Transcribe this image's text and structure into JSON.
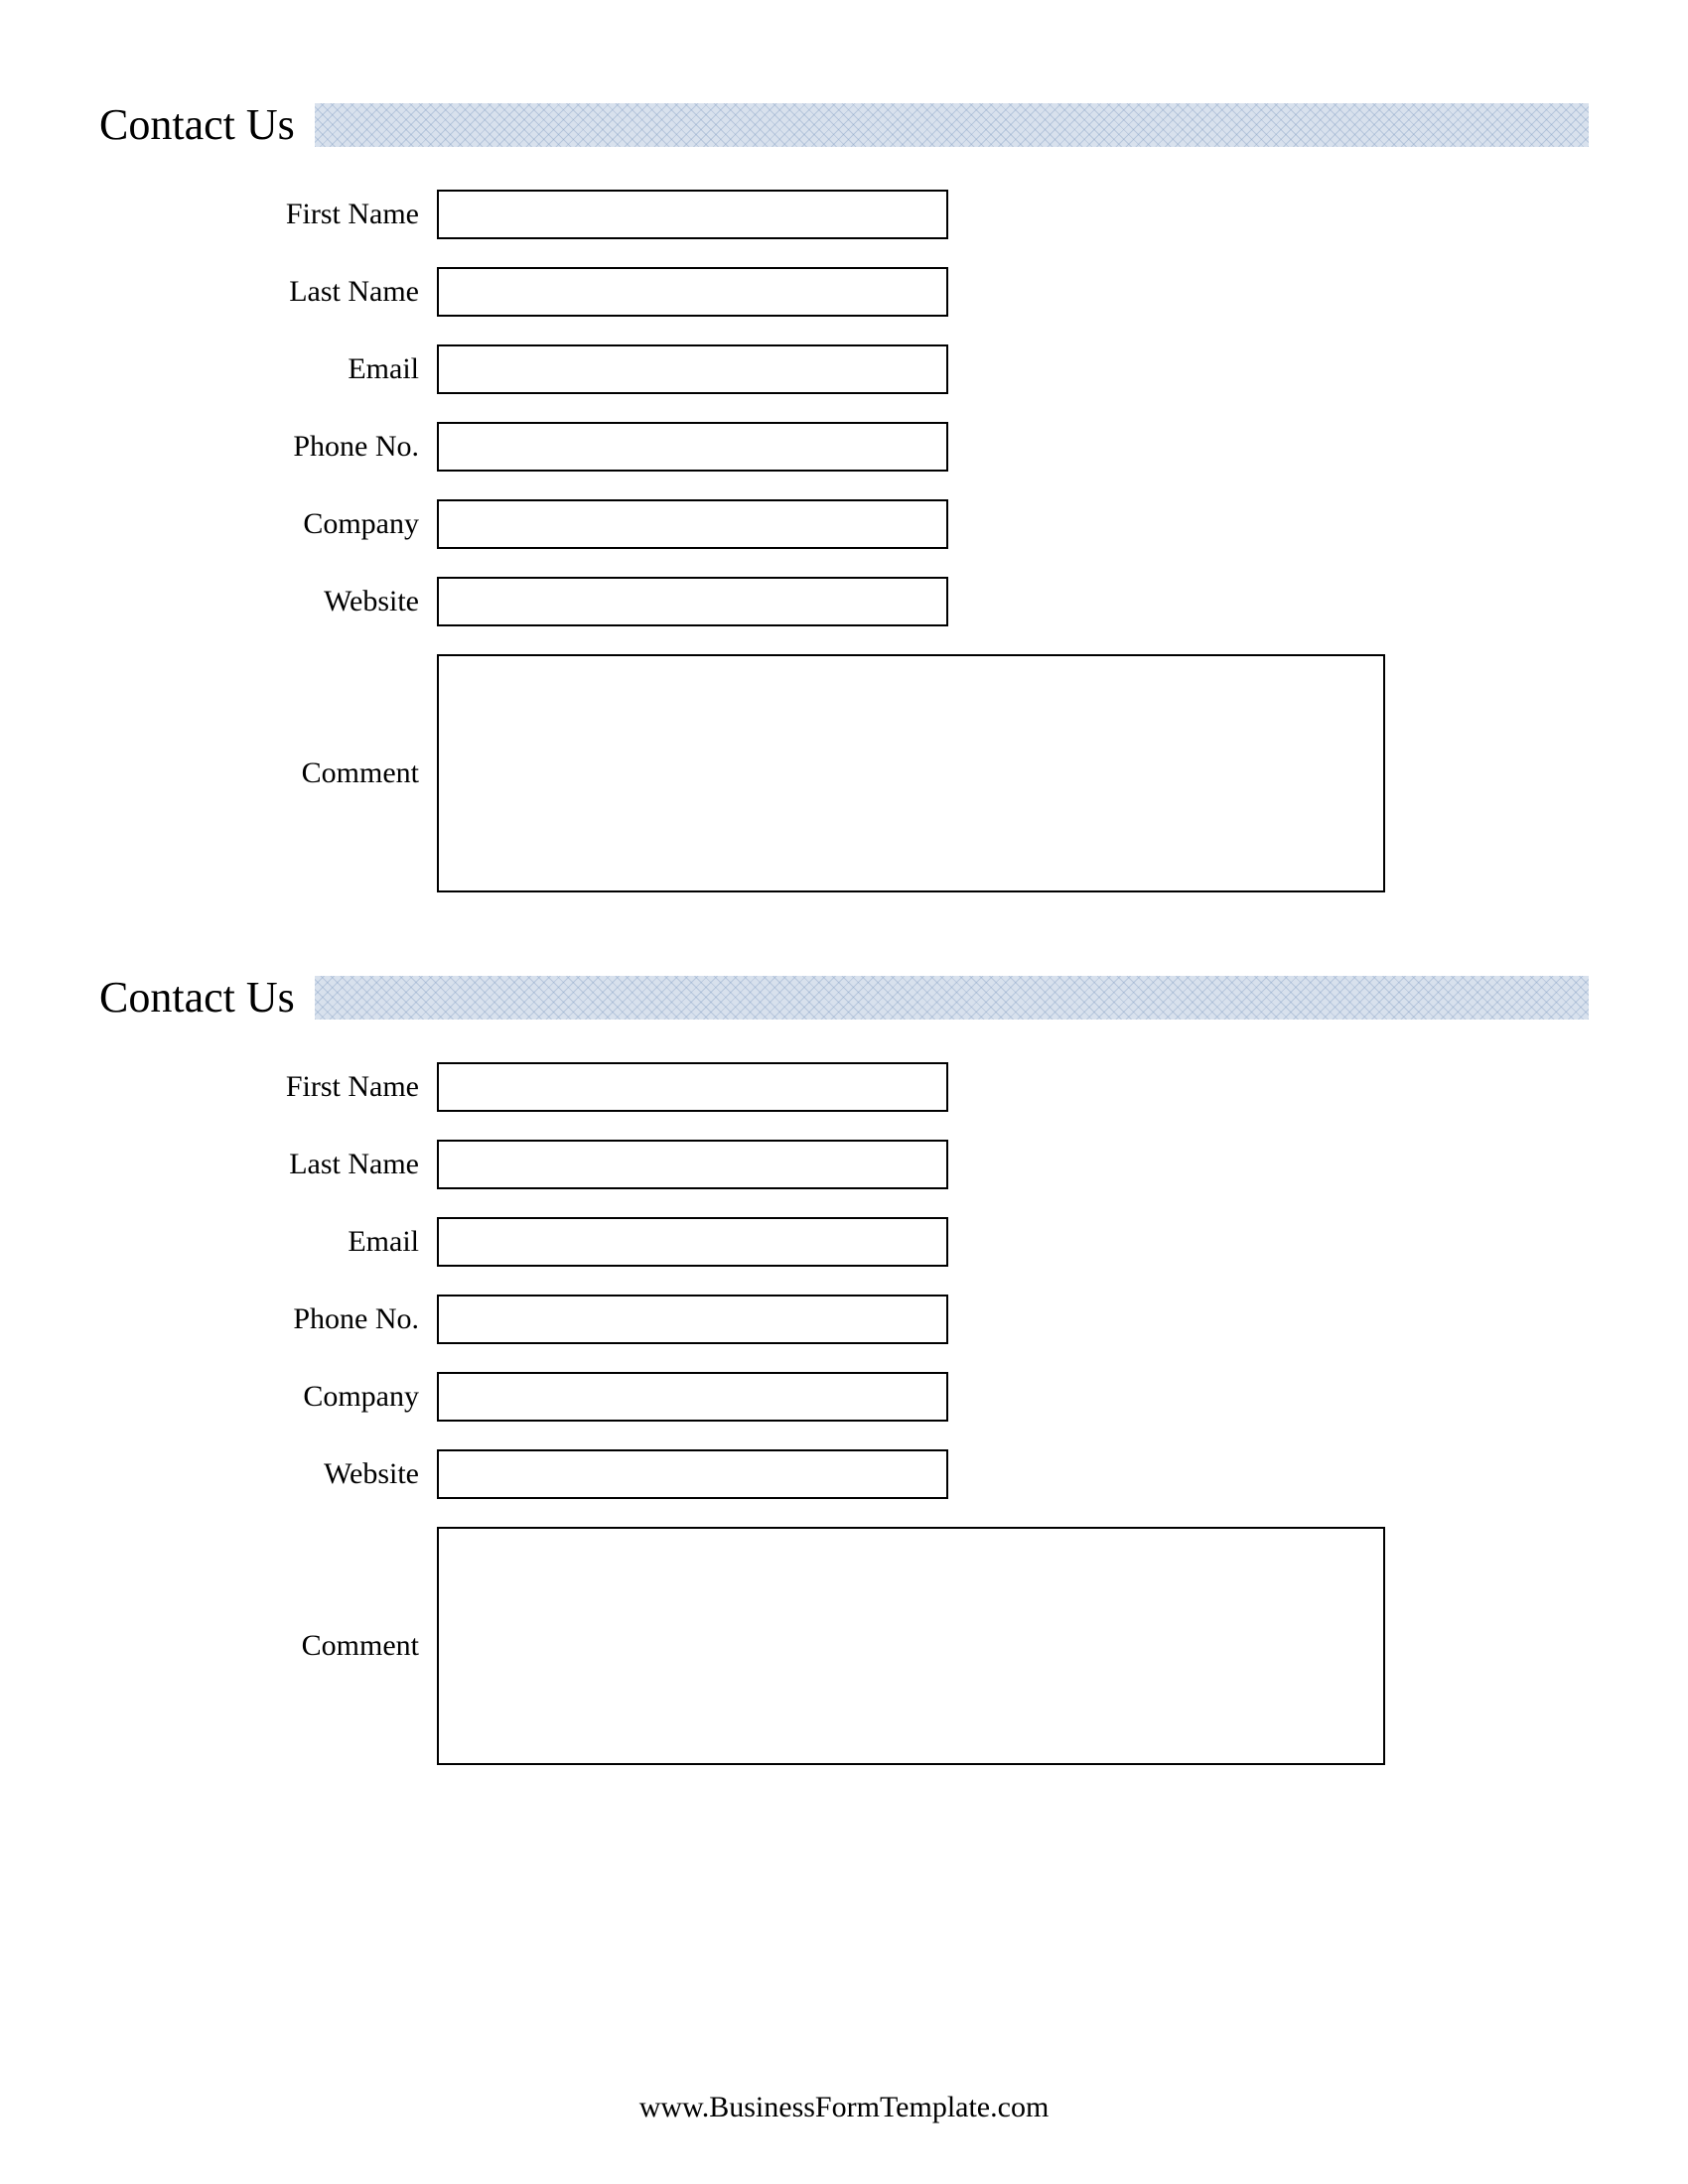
{
  "forms": [
    {
      "title": "Contact Us",
      "fields": [
        {
          "label": "First Name",
          "value": ""
        },
        {
          "label": "Last Name",
          "value": ""
        },
        {
          "label": "Email",
          "value": ""
        },
        {
          "label": "Phone No.",
          "value": ""
        },
        {
          "label": "Company",
          "value": ""
        },
        {
          "label": "Website",
          "value": ""
        }
      ],
      "comment_label": "Comment",
      "comment_value": ""
    },
    {
      "title": "Contact Us",
      "fields": [
        {
          "label": "First Name",
          "value": ""
        },
        {
          "label": "Last Name",
          "value": ""
        },
        {
          "label": "Email",
          "value": ""
        },
        {
          "label": "Phone No.",
          "value": ""
        },
        {
          "label": "Company",
          "value": ""
        },
        {
          "label": "Website",
          "value": ""
        }
      ],
      "comment_label": "Comment",
      "comment_value": ""
    }
  ],
  "footer": "www.BusinessFormTemplate.com"
}
